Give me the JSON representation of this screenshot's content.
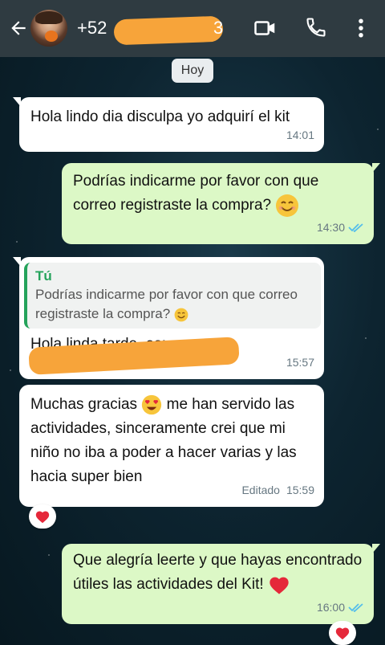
{
  "header": {
    "contact_prefix": "+52",
    "contact_suffix": "3"
  },
  "date_chip": "Hoy",
  "messages": [
    {
      "text": "Hola lindo dia disculpa yo adquirí el kit",
      "time": "14:01"
    },
    {
      "text": "Podrías indicarme por favor con que correo registraste la compra?",
      "time": "14:30"
    },
    {
      "quote_author": "Tú",
      "quote_text": "Podrías indicarme por favor con que correo registraste la compra?",
      "text": "Hola linda tarde, es:",
      "time": "15:57"
    },
    {
      "text_a": "Muchas gracias",
      "text_b": "me han servido las actividades, sinceramente crei que mi niño no iba a poder a hacer varias y las hacia super bien",
      "edited": "Editado",
      "time": "15:59"
    },
    {
      "text": "Que alegría leerte y que hayas encontrado útiles las actividades del Kit!",
      "time": "16:00"
    }
  ],
  "colors": {
    "header_bg": "#2f3b41",
    "outgoing_bubble": "#dcf8c6",
    "incoming_bubble": "#ffffff",
    "read_ticks": "#53bdeb",
    "quote_accent": "#25a35b",
    "redaction": "#f7a43a"
  },
  "icons": [
    "back-arrow-icon",
    "video-call-icon",
    "phone-icon",
    "more-options-icon",
    "smile-emoji-icon",
    "heart-eyes-emoji-icon",
    "heart-icon",
    "read-ticks-icon"
  ]
}
